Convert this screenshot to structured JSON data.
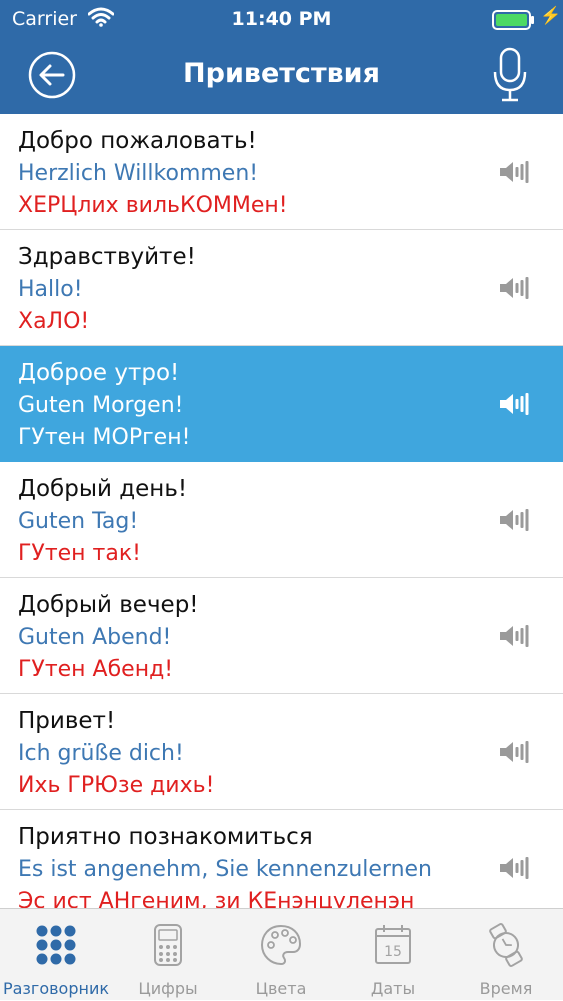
{
  "status_bar": {
    "carrier": "Carrier",
    "time": "11:40 PM"
  },
  "nav": {
    "title": "Приветствия",
    "back_icon": "back-arrow-icon",
    "mic_icon": "microphone-icon"
  },
  "colors": {
    "accent": "#2f6aa8",
    "selected_row": "#3fa6de",
    "german_text": "#3e78b3",
    "transliteration_text": "#e02020"
  },
  "phrases": [
    {
      "ru": "Добро пожаловать!",
      "de": "Herzlich Willkommen!",
      "tr": "ХЕРЦлих вильКОММен!",
      "selected": false
    },
    {
      "ru": "Здравствуйте!",
      "de": "Hallo!",
      "tr": "ХаЛО!",
      "selected": false
    },
    {
      "ru": "Доброе утро!",
      "de": "Guten Morgen!",
      "tr": "ГУтен МОРген!",
      "selected": true
    },
    {
      "ru": "Добрый день!",
      "de": "Guten Tag!",
      "tr": "ГУтен так!",
      "selected": false
    },
    {
      "ru": "Добрый вечер!",
      "de": "Guten Abend!",
      "tr": "ГУтен Абенд!",
      "selected": false
    },
    {
      "ru": "Привет!",
      "de": "Ich grüße dich!",
      "tr": "Ихь ГРЮзе дихь!",
      "selected": false
    },
    {
      "ru": "Приятно познакомиться",
      "de": "Es ist angenehm, Sie kennenzulernen",
      "tr": "Эс ист АНгеним, зи КЕнэнцуленэн",
      "selected": false
    }
  ],
  "tabs": [
    {
      "label": "Разговорник",
      "icon": "dots-grid-icon",
      "active": true
    },
    {
      "label": "Цифры",
      "icon": "calculator-icon",
      "active": false
    },
    {
      "label": "Цвета",
      "icon": "palette-icon",
      "active": false
    },
    {
      "label": "Даты",
      "icon": "calendar-icon",
      "active": false,
      "icon_text": "15"
    },
    {
      "label": "Время",
      "icon": "watch-icon",
      "active": false
    }
  ]
}
